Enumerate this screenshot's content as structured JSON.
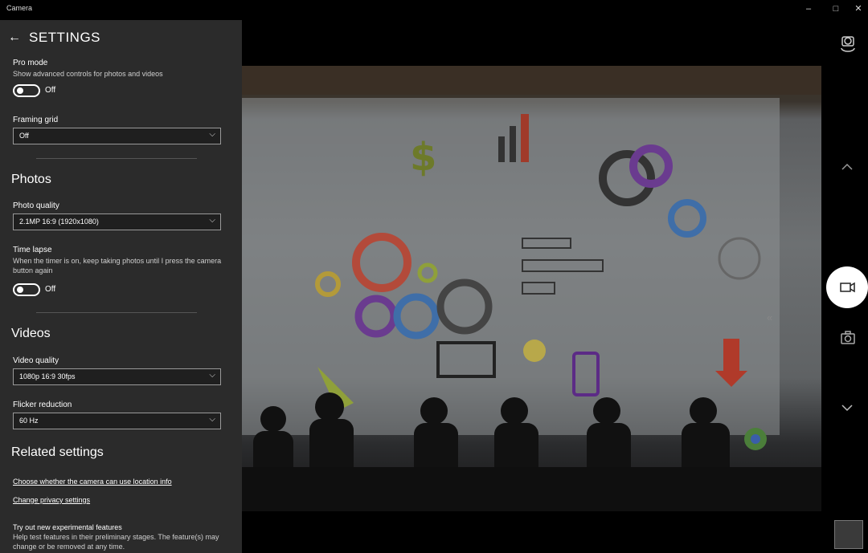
{
  "window": {
    "title": "Camera",
    "minimize": "–",
    "maximize": "□",
    "close": "✕"
  },
  "settings": {
    "back_glyph": "←",
    "title": "SETTINGS",
    "pro_mode": {
      "label": "Pro mode",
      "description": "Show advanced controls for photos and videos",
      "state": "Off"
    },
    "framing_grid": {
      "label": "Framing grid",
      "value": "Off"
    },
    "photos": {
      "heading": "Photos",
      "photo_quality": {
        "label": "Photo quality",
        "value": "2.1MP 16:9 (1920x1080)"
      },
      "time_lapse": {
        "label": "Time lapse",
        "description": "When the timer is on, keep taking photos until I press the camera button again",
        "state": "Off"
      }
    },
    "videos": {
      "heading": "Videos",
      "video_quality": {
        "label": "Video quality",
        "value": "1080p 16:9 30fps"
      },
      "flicker_reduction": {
        "label": "Flicker reduction",
        "value": "60 Hz"
      }
    },
    "related": {
      "heading": "Related settings",
      "location_link": "Choose whether the camera can use location info",
      "privacy_link": "Change privacy settings"
    },
    "experimental": {
      "title": "Try out new experimental features",
      "description": "Help test features in their preliminary stages. The feature(s) may change or be removed at any time."
    }
  },
  "icons": {
    "switch_camera": "switch-camera-icon",
    "video": "video-camera-icon",
    "photo": "photo-camera-icon"
  },
  "colors": {
    "panel_bg": "#2b2b2b",
    "app_bg": "#000000",
    "accent": "#ffffff"
  }
}
